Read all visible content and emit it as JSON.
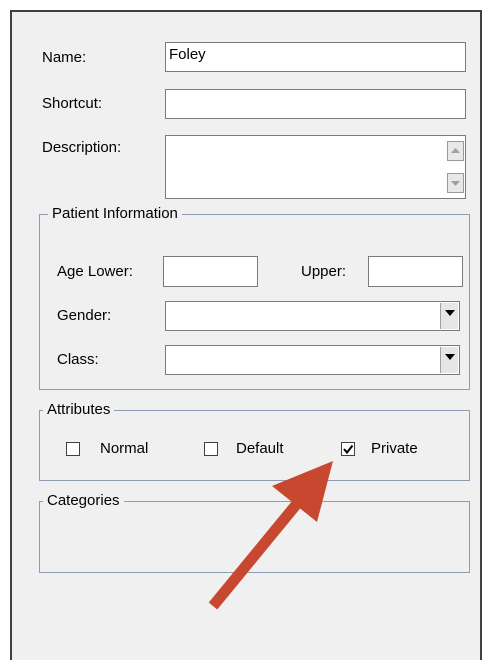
{
  "form": {
    "name_label": "Name:",
    "name_value": "Foley",
    "shortcut_label": "Shortcut:",
    "shortcut_value": "",
    "description_label": "Description:",
    "description_value": ""
  },
  "patient_info": {
    "legend": "Patient Information",
    "age_lower_label": "Age Lower:",
    "age_lower_value": "",
    "upper_label": "Upper:",
    "upper_value": "",
    "gender_label": "Gender:",
    "gender_value": "",
    "class_label": "Class:",
    "class_value": ""
  },
  "attributes": {
    "legend": "Attributes",
    "items": [
      {
        "label": "Normal",
        "checked": false
      },
      {
        "label": "Default",
        "checked": false
      },
      {
        "label": "Private",
        "checked": true
      }
    ]
  },
  "categories": {
    "legend": "Categories"
  },
  "annotation": {
    "arrow_color": "#c8472f"
  },
  "icons": {
    "scroll_up": "scroll-up-icon",
    "scroll_down": "scroll-down-icon",
    "dropdown": "chevron-down-icon",
    "checkmark": "checkmark-icon"
  }
}
